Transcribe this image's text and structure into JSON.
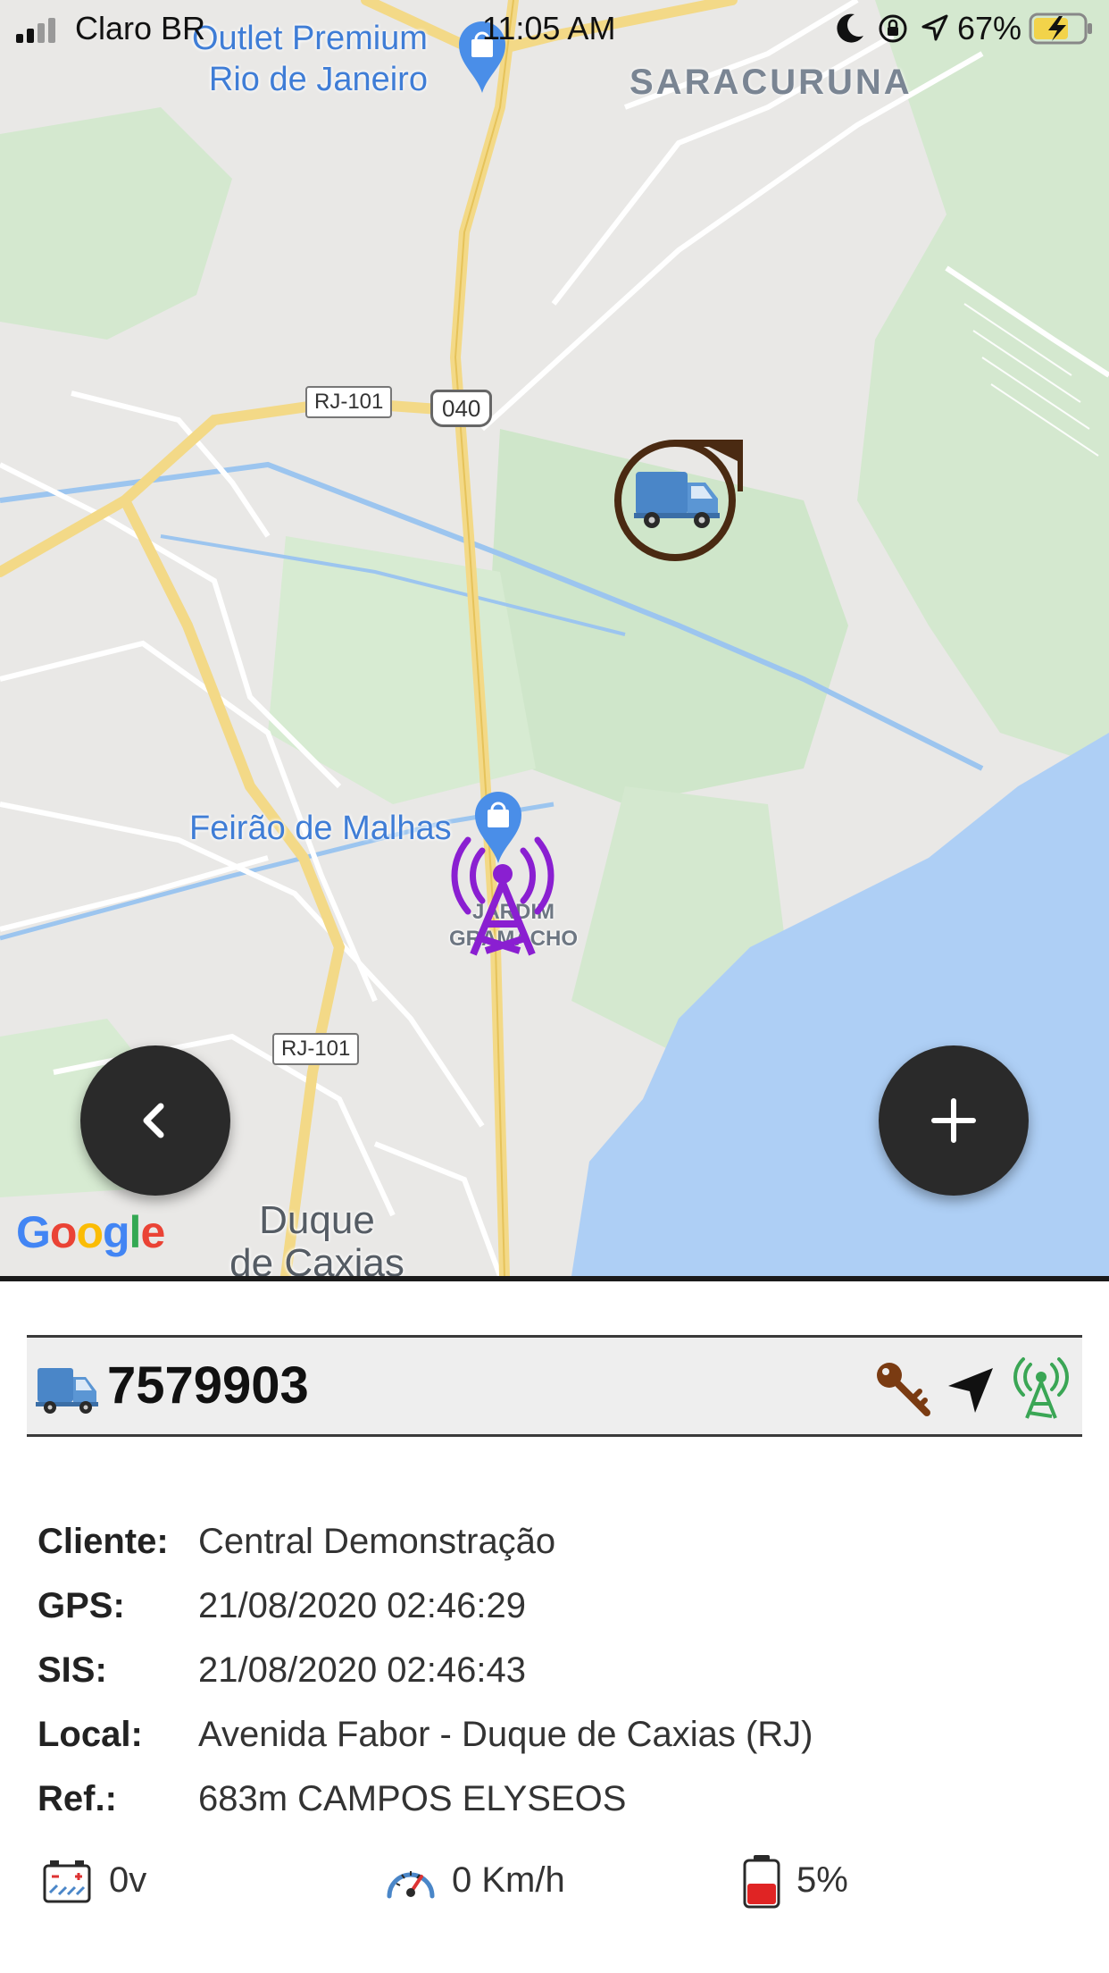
{
  "status_bar": {
    "carrier": "Claro BR",
    "time": "11:05 AM",
    "battery_percent": "67%"
  },
  "map": {
    "poi_outlet": "Outlet Premium\nRio de Janeiro",
    "poi_outlet_line1": "Outlet Premium",
    "poi_outlet_line2": "Rio de Janeiro",
    "area_saracuruna": "SARACURUNA",
    "poi_feirao": "Feirão de Malhas",
    "area_jardim_line1": "JARDIM",
    "area_jardim_line2": "GRAMACHO",
    "road_rj101_a": "RJ-101",
    "road_040": "040",
    "road_rj101_b": "RJ-101",
    "city_line1": "Duque",
    "city_line2": "de Caxias",
    "google": "Google"
  },
  "vehicle": {
    "id": "7579903",
    "fields": [
      {
        "label": "Cliente:",
        "value": "Central Demonstração"
      },
      {
        "label": "GPS:",
        "value": "21/08/2020 02:46:29"
      },
      {
        "label": "SIS:",
        "value": "21/08/2020 02:46:43"
      },
      {
        "label": "Local:",
        "value": "Avenida Fabor - Duque de Caxias (RJ)"
      },
      {
        "label": "Ref.:",
        "value": "683m CAMPOS ELYSEOS"
      }
    ],
    "voltage": "0v",
    "speed": "0 Km/h",
    "battery": "5%",
    "battery_level": 0.05
  },
  "colors": {
    "ignition_key": "#7a3b12",
    "signal_ok": "#3aa655",
    "tower_marker": "#8a1fd1",
    "truck_ring": "#4a2a12"
  },
  "icons": [
    "back-chevron-icon",
    "plus-icon",
    "truck-icon",
    "key-icon",
    "navigation-arrow-icon",
    "signal-tower-icon",
    "car-battery-icon",
    "speedometer-icon",
    "battery-icon"
  ]
}
